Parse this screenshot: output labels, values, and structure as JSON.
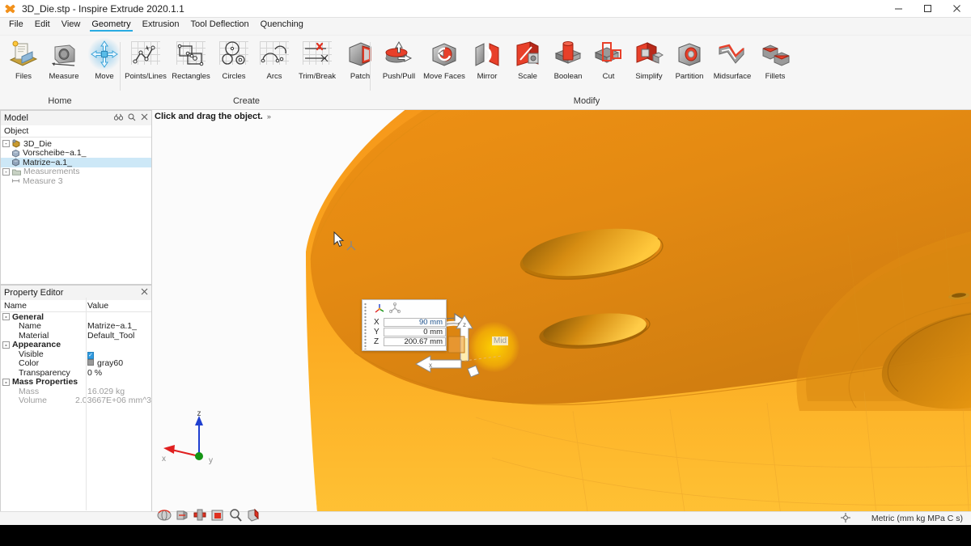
{
  "window": {
    "title": "3D_Die.stp - Inspire Extrude 2020.1.1",
    "app_icon": "inspire-logo-icon",
    "minimize": "—",
    "maximize": "❐",
    "close": "✕"
  },
  "menubar": {
    "items": [
      {
        "label": "File",
        "active": false
      },
      {
        "label": "Edit",
        "active": false
      },
      {
        "label": "View",
        "active": false
      },
      {
        "label": "Geometry",
        "active": true
      },
      {
        "label": "Extrusion",
        "active": false
      },
      {
        "label": "Tool Deflection",
        "active": false
      },
      {
        "label": "Quenching",
        "active": false
      }
    ]
  },
  "ribbon": {
    "groups": [
      {
        "name": "Home",
        "label": "Home",
        "buttons": [
          {
            "label": "Files",
            "icon": "files-icon"
          },
          {
            "label": "Measure",
            "icon": "measure-icon"
          },
          {
            "label": "Move",
            "icon": "move-icon",
            "selected": true
          }
        ]
      },
      {
        "name": "Create",
        "label": "Create",
        "buttons": [
          {
            "label": "Points/Lines",
            "icon": "points-lines-icon"
          },
          {
            "label": "Rectangles",
            "icon": "rectangles-icon"
          },
          {
            "label": "Circles",
            "icon": "circles-icon"
          },
          {
            "label": "Arcs",
            "icon": "arcs-icon"
          },
          {
            "label": "Trim/Break",
            "icon": "trim-break-icon"
          },
          {
            "label": "Patch",
            "icon": "patch-icon"
          }
        ]
      },
      {
        "name": "Modify",
        "label": "Modify",
        "buttons": [
          {
            "label": "Push/Pull",
            "icon": "push-pull-icon"
          },
          {
            "label": "Move Faces",
            "icon": "move-faces-icon"
          },
          {
            "label": "Mirror",
            "icon": "mirror-icon"
          },
          {
            "label": "Scale",
            "icon": "scale-icon"
          },
          {
            "label": "Boolean",
            "icon": "boolean-icon"
          },
          {
            "label": "Cut",
            "icon": "cut-icon"
          },
          {
            "label": "Simplify",
            "icon": "simplify-icon"
          },
          {
            "label": "Partition",
            "icon": "partition-icon"
          },
          {
            "label": "Midsurface",
            "icon": "midsurface-icon"
          },
          {
            "label": "Fillets",
            "icon": "fillets-icon"
          }
        ]
      }
    ]
  },
  "model_panel": {
    "title": "Model",
    "tools": [
      "binoculars-icon",
      "search-icon",
      "close-icon"
    ],
    "column_header": "Object",
    "tree": [
      {
        "label": "3D_Die",
        "level": 0,
        "expander": "-",
        "icon": "assembly-icon",
        "selected": false,
        "dim": false
      },
      {
        "label": "Vorscheibe~a.1_",
        "level": 1,
        "expander": "",
        "icon": "part-icon",
        "selected": false,
        "dim": false
      },
      {
        "label": "Matrize~a.1_",
        "level": 1,
        "expander": "",
        "icon": "part-icon",
        "selected": true,
        "dim": false
      },
      {
        "label": "Measurements",
        "level": 0,
        "expander": "-",
        "icon": "folder-icon",
        "selected": false,
        "dim": true
      },
      {
        "label": "Measure 3",
        "level": 1,
        "expander": "",
        "icon": "measure-item-icon",
        "selected": false,
        "dim": true
      }
    ]
  },
  "property_editor": {
    "title": "Property Editor",
    "close": "✕",
    "columns": [
      "Name",
      "Value"
    ],
    "rows": [
      {
        "name": "General",
        "value": "",
        "group": true,
        "expander": "-",
        "dim": false
      },
      {
        "name": "Name",
        "value": "Matrize~a.1_",
        "group": false,
        "dim": false
      },
      {
        "name": "Material",
        "value": "Default_Tool",
        "group": false,
        "dim": false
      },
      {
        "name": "Appearance",
        "value": "",
        "group": true,
        "expander": "-",
        "dim": false
      },
      {
        "name": "Visible",
        "value": "",
        "group": false,
        "dim": false,
        "checkbox": true
      },
      {
        "name": "Color",
        "value": "gray60",
        "group": false,
        "dim": false,
        "swatch": "#999999"
      },
      {
        "name": "Transparency",
        "value": "0 %",
        "group": false,
        "dim": false
      },
      {
        "name": "Mass Properties",
        "value": "",
        "group": true,
        "expander": "-",
        "dim": false
      },
      {
        "name": "Mass",
        "value": "16.029 kg",
        "group": false,
        "dim": true
      },
      {
        "name": "Volume",
        "value": "2.03667E+06 mm^3",
        "group": false,
        "dim": true
      }
    ]
  },
  "viewport": {
    "hint": "Click and drag the object.",
    "hint_chevron": "»",
    "snap_label": "Mid",
    "gizmo": {
      "x_axis_arrow": "x-axis-arrow",
      "z_axis_arrow": "z-axis-arrow",
      "rotate_handle": "rotate-arc-arrow",
      "plane_handle": "plane-translate-handle"
    },
    "triad": {
      "x": "x",
      "y": "y",
      "z": "z",
      "x_color": "#e02020",
      "y_color": "#149414",
      "z_color": "#2040d0"
    },
    "tools": [
      {
        "icon": "rotate-view-icon",
        "label": "Rotate"
      },
      {
        "icon": "pan-view-icon",
        "label": "Pan"
      },
      {
        "icon": "fit-view-icon",
        "label": "Fit"
      },
      {
        "icon": "zoom-window-icon",
        "label": "Zoom Window"
      },
      {
        "icon": "magnifier-icon",
        "label": "Zoom"
      },
      {
        "icon": "section-view-icon",
        "label": "Section"
      }
    ]
  },
  "coord_dialog": {
    "icons": [
      "triad-axis-icon",
      "free-move-icon"
    ],
    "fields": [
      {
        "label": "X",
        "value": "90 mm",
        "highlight": true
      },
      {
        "label": "Y",
        "value": "0 mm",
        "highlight": false
      },
      {
        "label": "Z",
        "value": "200.67 mm",
        "highlight": false
      }
    ]
  },
  "statusbar": {
    "target_icon": "crosshair-icon",
    "units": "Metric (mm kg MPa C s)"
  },
  "colors": {
    "accent": "#29abe2",
    "part_orange": "#f2921d",
    "part_orange_dark": "#d07d10",
    "part_orange_light": "#ffc03a",
    "selection": "#cde8f7",
    "highlight_yellow": "#ffd600"
  }
}
